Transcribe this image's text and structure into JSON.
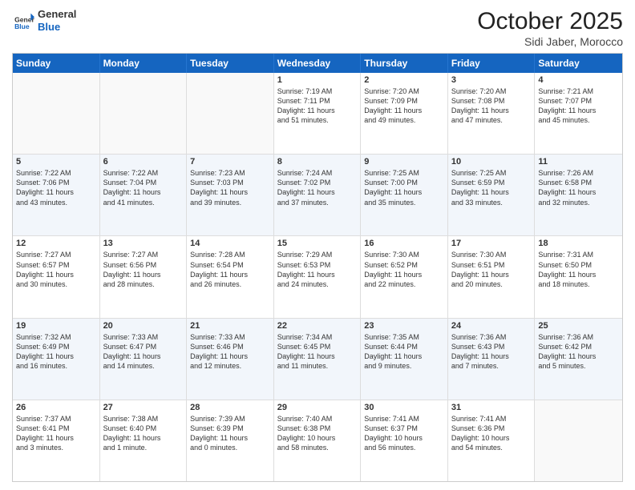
{
  "header": {
    "logo_general": "General",
    "logo_blue": "Blue",
    "month_title": "October 2025",
    "location": "Sidi Jaber, Morocco"
  },
  "weekdays": [
    "Sunday",
    "Monday",
    "Tuesday",
    "Wednesday",
    "Thursday",
    "Friday",
    "Saturday"
  ],
  "rows": [
    [
      {
        "day": "",
        "text": "",
        "empty": true
      },
      {
        "day": "",
        "text": "",
        "empty": true
      },
      {
        "day": "",
        "text": "",
        "empty": true
      },
      {
        "day": "1",
        "text": "Sunrise: 7:19 AM\nSunset: 7:11 PM\nDaylight: 11 hours\nand 51 minutes."
      },
      {
        "day": "2",
        "text": "Sunrise: 7:20 AM\nSunset: 7:09 PM\nDaylight: 11 hours\nand 49 minutes."
      },
      {
        "day": "3",
        "text": "Sunrise: 7:20 AM\nSunset: 7:08 PM\nDaylight: 11 hours\nand 47 minutes."
      },
      {
        "day": "4",
        "text": "Sunrise: 7:21 AM\nSunset: 7:07 PM\nDaylight: 11 hours\nand 45 minutes."
      }
    ],
    [
      {
        "day": "5",
        "text": "Sunrise: 7:22 AM\nSunset: 7:06 PM\nDaylight: 11 hours\nand 43 minutes."
      },
      {
        "day": "6",
        "text": "Sunrise: 7:22 AM\nSunset: 7:04 PM\nDaylight: 11 hours\nand 41 minutes."
      },
      {
        "day": "7",
        "text": "Sunrise: 7:23 AM\nSunset: 7:03 PM\nDaylight: 11 hours\nand 39 minutes."
      },
      {
        "day": "8",
        "text": "Sunrise: 7:24 AM\nSunset: 7:02 PM\nDaylight: 11 hours\nand 37 minutes."
      },
      {
        "day": "9",
        "text": "Sunrise: 7:25 AM\nSunset: 7:00 PM\nDaylight: 11 hours\nand 35 minutes."
      },
      {
        "day": "10",
        "text": "Sunrise: 7:25 AM\nSunset: 6:59 PM\nDaylight: 11 hours\nand 33 minutes."
      },
      {
        "day": "11",
        "text": "Sunrise: 7:26 AM\nSunset: 6:58 PM\nDaylight: 11 hours\nand 32 minutes."
      }
    ],
    [
      {
        "day": "12",
        "text": "Sunrise: 7:27 AM\nSunset: 6:57 PM\nDaylight: 11 hours\nand 30 minutes."
      },
      {
        "day": "13",
        "text": "Sunrise: 7:27 AM\nSunset: 6:56 PM\nDaylight: 11 hours\nand 28 minutes."
      },
      {
        "day": "14",
        "text": "Sunrise: 7:28 AM\nSunset: 6:54 PM\nDaylight: 11 hours\nand 26 minutes."
      },
      {
        "day": "15",
        "text": "Sunrise: 7:29 AM\nSunset: 6:53 PM\nDaylight: 11 hours\nand 24 minutes."
      },
      {
        "day": "16",
        "text": "Sunrise: 7:30 AM\nSunset: 6:52 PM\nDaylight: 11 hours\nand 22 minutes."
      },
      {
        "day": "17",
        "text": "Sunrise: 7:30 AM\nSunset: 6:51 PM\nDaylight: 11 hours\nand 20 minutes."
      },
      {
        "day": "18",
        "text": "Sunrise: 7:31 AM\nSunset: 6:50 PM\nDaylight: 11 hours\nand 18 minutes."
      }
    ],
    [
      {
        "day": "19",
        "text": "Sunrise: 7:32 AM\nSunset: 6:49 PM\nDaylight: 11 hours\nand 16 minutes."
      },
      {
        "day": "20",
        "text": "Sunrise: 7:33 AM\nSunset: 6:47 PM\nDaylight: 11 hours\nand 14 minutes."
      },
      {
        "day": "21",
        "text": "Sunrise: 7:33 AM\nSunset: 6:46 PM\nDaylight: 11 hours\nand 12 minutes."
      },
      {
        "day": "22",
        "text": "Sunrise: 7:34 AM\nSunset: 6:45 PM\nDaylight: 11 hours\nand 11 minutes."
      },
      {
        "day": "23",
        "text": "Sunrise: 7:35 AM\nSunset: 6:44 PM\nDaylight: 11 hours\nand 9 minutes."
      },
      {
        "day": "24",
        "text": "Sunrise: 7:36 AM\nSunset: 6:43 PM\nDaylight: 11 hours\nand 7 minutes."
      },
      {
        "day": "25",
        "text": "Sunrise: 7:36 AM\nSunset: 6:42 PM\nDaylight: 11 hours\nand 5 minutes."
      }
    ],
    [
      {
        "day": "26",
        "text": "Sunrise: 7:37 AM\nSunset: 6:41 PM\nDaylight: 11 hours\nand 3 minutes."
      },
      {
        "day": "27",
        "text": "Sunrise: 7:38 AM\nSunset: 6:40 PM\nDaylight: 11 hours\nand 1 minute."
      },
      {
        "day": "28",
        "text": "Sunrise: 7:39 AM\nSunset: 6:39 PM\nDaylight: 11 hours\nand 0 minutes."
      },
      {
        "day": "29",
        "text": "Sunrise: 7:40 AM\nSunset: 6:38 PM\nDaylight: 10 hours\nand 58 minutes."
      },
      {
        "day": "30",
        "text": "Sunrise: 7:41 AM\nSunset: 6:37 PM\nDaylight: 10 hours\nand 56 minutes."
      },
      {
        "day": "31",
        "text": "Sunrise: 7:41 AM\nSunset: 6:36 PM\nDaylight: 10 hours\nand 54 minutes."
      },
      {
        "day": "",
        "text": "",
        "empty": true
      }
    ]
  ]
}
